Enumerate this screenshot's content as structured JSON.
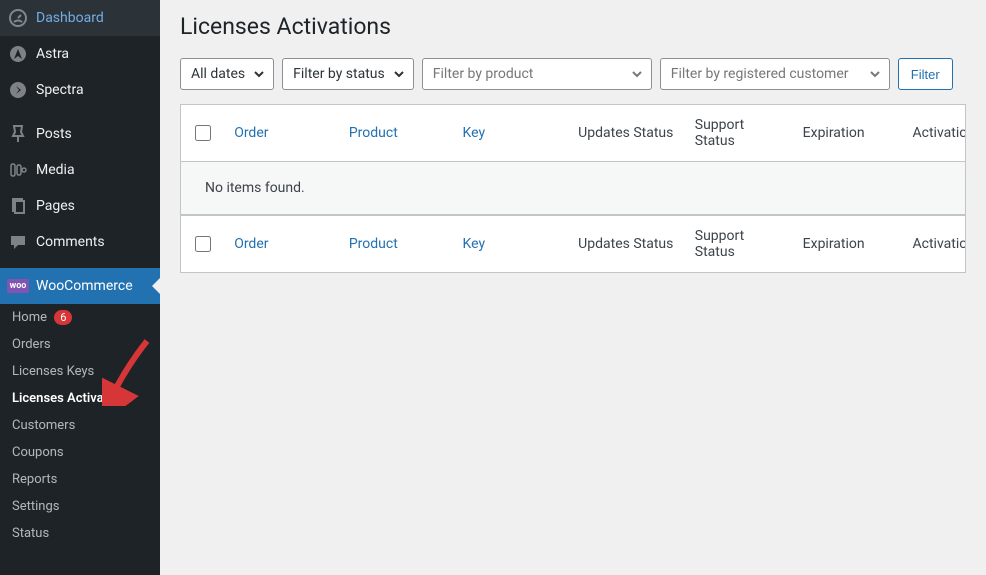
{
  "sidebar": {
    "items": [
      {
        "icon": "dashboard",
        "label": "Dashboard"
      },
      {
        "icon": "astra",
        "label": "Astra"
      },
      {
        "icon": "spectra",
        "label": "Spectra"
      },
      {
        "icon": "pin",
        "label": "Posts"
      },
      {
        "icon": "media",
        "label": "Media"
      },
      {
        "icon": "pages",
        "label": "Pages"
      },
      {
        "icon": "comments",
        "label": "Comments"
      },
      {
        "icon": "woo",
        "label": "WooCommerce"
      }
    ],
    "submenus": [
      {
        "label": "Home",
        "badge": "6"
      },
      {
        "label": "Orders"
      },
      {
        "label": "Licenses Keys"
      },
      {
        "label": "Licenses Activations",
        "active": true
      },
      {
        "label": "Customers"
      },
      {
        "label": "Coupons"
      },
      {
        "label": "Reports"
      },
      {
        "label": "Settings"
      },
      {
        "label": "Status"
      }
    ]
  },
  "page": {
    "title": "Licenses Activations"
  },
  "filters": {
    "dates": "All dates",
    "status": "Filter by status",
    "product_placeholder": "Filter by product",
    "customer_placeholder": "Filter by registered customer",
    "filter_btn": "Filter"
  },
  "table": {
    "columns": {
      "order": "Order",
      "product": "Product",
      "key": "Key",
      "updates": "Updates Status",
      "support": "Support Status",
      "expiration": "Expiration",
      "activation": "Activation Status"
    },
    "empty": "No items found."
  }
}
